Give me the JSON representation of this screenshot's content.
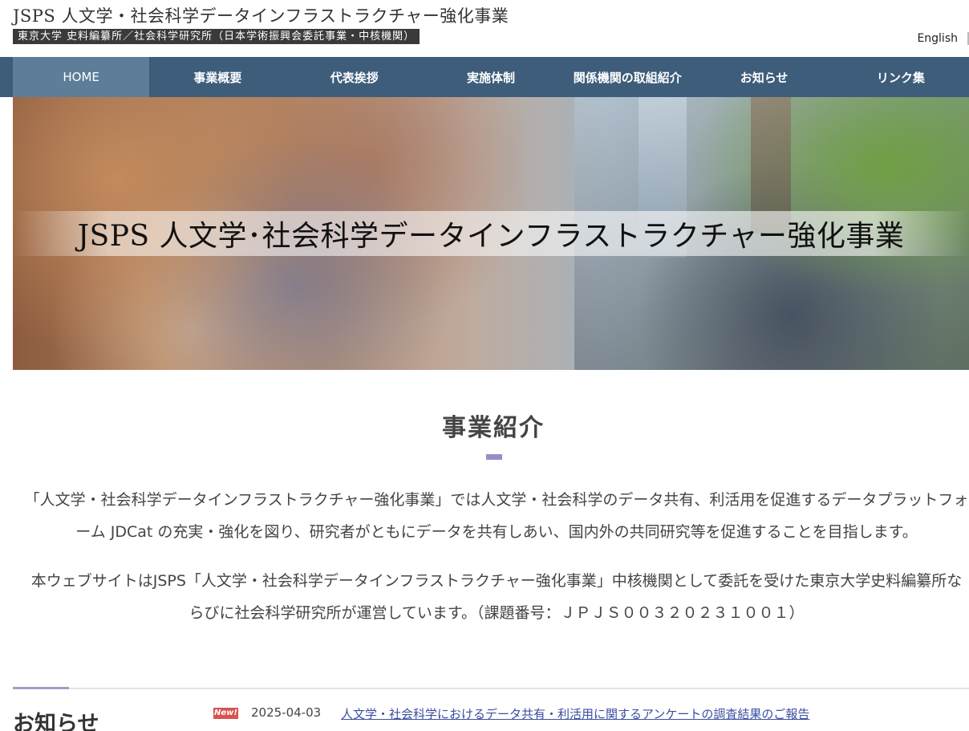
{
  "header": {
    "site_title": "JSPS 人文学・社会科学データインフラストラクチャー強化事業",
    "site_subtitle": "東京大学 史料編纂所／社会科学研究所（日本学術振興会委託事業・中核機関）",
    "language_link": "English"
  },
  "nav": {
    "items": [
      {
        "label": "HOME"
      },
      {
        "label": "事業概要"
      },
      {
        "label": "代表挨拶"
      },
      {
        "label": "実施体制"
      },
      {
        "label": "関係機関の取組紹介"
      },
      {
        "label": "お知らせ"
      },
      {
        "label": "リンク集"
      }
    ],
    "active_index": 0
  },
  "hero": {
    "title": "JSPS 人文学･社会科学データインフラストラクチャー強化事業"
  },
  "intro": {
    "heading": "事業紹介",
    "paragraph1": "「人文学・社会科学データインフラストラクチャー強化事業」では人文学・社会科学のデータ共有、利活用を促進するデータプラットフォーム JDCat の充実・強化を図り、研究者がともにデータを共有しあい、国内外の共同研究等を促進することを目指します。",
    "paragraph2": "本ウェブサイトはJSPS「人文学・社会科学データインフラストラクチャー強化事業」中核機関として委託を受けた東京大学史料編纂所ならびに社会科学研究所が運営しています。（課題番号：ＪＰＪＳ００３２０２３１００１）"
  },
  "news": {
    "heading": "お知らせ",
    "items": [
      {
        "badge": "New!",
        "date": "2025-04-03",
        "title": "人文学・社会科学におけるデータ共有・利活用に関するアンケートの調査結果のご報告"
      }
    ]
  },
  "colors": {
    "nav_background": "#3e5d7b",
    "nav_active": "#5e7d99",
    "accent_purple": "#9a8dc4",
    "link_blue": "#3b4ea0",
    "badge_red": "#d9534f"
  }
}
